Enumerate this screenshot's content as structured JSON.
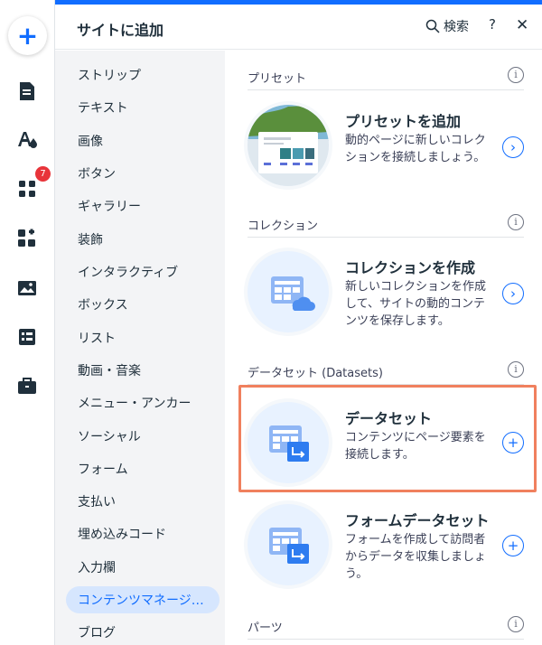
{
  "rail": {
    "add_label": "+",
    "badge_count": "7",
    "accent": "#116dff"
  },
  "header": {
    "title": "サイトに追加",
    "search_label": "検索",
    "help_label": "?",
    "close_label": "✕"
  },
  "categories": [
    "ストリップ",
    "テキスト",
    "画像",
    "ボタン",
    "ギャラリー",
    "装飾",
    "インタラクティブ",
    "ボックス",
    "リスト",
    "動画・音楽",
    "メニュー・アンカー",
    "ソーシャル",
    "フォーム",
    "支払い",
    "埋め込みコード",
    "入力欄",
    "コンテンツマネージ…",
    "ブログ"
  ],
  "active_category": "コンテンツマネージ…",
  "sections": {
    "preset": {
      "title": "プリセット",
      "card_title": "プリセットを追加",
      "card_desc": "動的ページに新しいコレクションを接続しましょう。"
    },
    "collection": {
      "title": "コレクション",
      "card_title": "コレクションを作成",
      "card_desc": "新しいコレクションを作成して、サイトの動的コンテンツを保存します。"
    },
    "datasets": {
      "title": "データセット (Datasets)",
      "dataset_title": "データセット",
      "dataset_desc": "コンテンツにページ要素を接続します。",
      "form_dataset_title": "フォームデータセット",
      "form_dataset_desc": "フォームを作成して訪問者からデータを収集しましょう。"
    },
    "parts": {
      "title": "パーツ"
    }
  },
  "info_glyph": "i"
}
